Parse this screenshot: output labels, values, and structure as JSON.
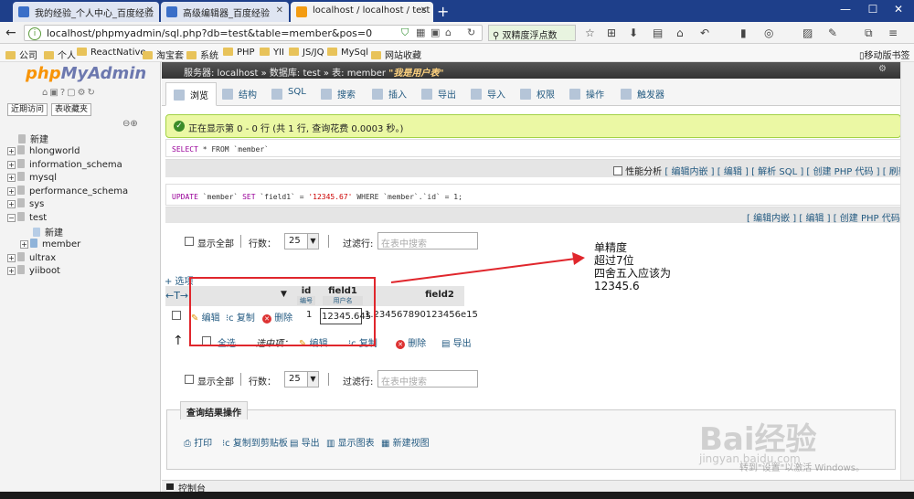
{
  "browser": {
    "tabs": [
      {
        "label": "我的经验_个人中心_百度经验"
      },
      {
        "label": "高级编辑器_百度经验"
      },
      {
        "label": "localhost / localhost / test"
      }
    ],
    "url": "localhost/phpmyadmin/sql.php?db=test&table=member&pos=0",
    "search_text": "双精度浮点数",
    "bookmarks": [
      "公司",
      "个人",
      "ReactNative",
      "淘宝套",
      "系统",
      "PHP",
      "YII",
      "JS/JQ",
      "MySql",
      "网站收藏"
    ],
    "mobile_bookmarks": "移动版书签"
  },
  "sidebar": {
    "logo_php": "php",
    "logo_myadmin": "MyAdmin",
    "recent_btn": "近期访问",
    "fav_btn": "表收藏夹",
    "tree": [
      {
        "label": "新建"
      },
      {
        "label": "hlongworld"
      },
      {
        "label": "information_schema"
      },
      {
        "label": "mysql"
      },
      {
        "label": "performance_schema"
      },
      {
        "label": "sys"
      },
      {
        "label": "test"
      },
      {
        "label": "新建"
      },
      {
        "label": "member"
      },
      {
        "label": "ultrax"
      },
      {
        "label": "yiiboot"
      }
    ]
  },
  "breadcrumb": {
    "server": "服务器: localhost »",
    "database": "数据库: test »",
    "table": "表: member",
    "comment": "\"我是用户表\""
  },
  "tabs": [
    {
      "label": "浏览"
    },
    {
      "label": "结构"
    },
    {
      "label": "SQL"
    },
    {
      "label": "搜索"
    },
    {
      "label": "插入"
    },
    {
      "label": "导出"
    },
    {
      "label": "导入"
    },
    {
      "label": "权限"
    },
    {
      "label": "操作"
    },
    {
      "label": "触发器"
    }
  ],
  "content": {
    "success_msg": "正在显示第 0 - 0 行 (共 1 行, 查询花费 0.0003 秒。)",
    "query1": {
      "kw1": "SELECT",
      "rest": " * FROM `member`"
    },
    "query1_links": {
      "profiling": "性能分析",
      "inline": "[ 编辑内嵌 ]",
      "edit": "[ 编辑 ]",
      "explain": "[ 解析 SQL ]",
      "php": "[ 创建 PHP 代码 ]",
      "refresh": "[ 刷新 ]"
    },
    "query2": {
      "kw1": "UPDATE",
      "t1": " `member` ",
      "kw2": "SET",
      "t2": " `field1` = ",
      "val": "'12345.67'",
      "t3": " WHERE `member`.`id` = 1;"
    },
    "query2_links": {
      "inline": "[ 编辑内嵌 ]",
      "edit": "[ 编辑 ]",
      "php": "[ 创建 PHP 代码 ]"
    },
    "nav": {
      "show_all": "显示全部",
      "rows_label": "行数：",
      "rows_value": "25",
      "filter_label": "过滤行:",
      "filter_placeholder": "在表中搜索"
    },
    "options_link": "+ 选项",
    "columns": {
      "id": "id",
      "id_sub": "编号",
      "field1": "field1",
      "field1_sub": "用户名",
      "field2": "field2"
    },
    "row": {
      "edit": "编辑",
      "copy": "复制",
      "delete": "删除",
      "id": "1",
      "field1": "12345.645",
      "field2": "1.234567890123456e15"
    },
    "bulk": {
      "check_all": "全选",
      "with_selected": "选中项：",
      "edit": "编辑",
      "copy": "复制",
      "delete": "删除",
      "export": "导出"
    },
    "result_ops": {
      "title": "查询结果操作",
      "print": "打印",
      "copy_clip": "复制到剪贴板",
      "export": "导出",
      "chart": "显示图表",
      "view": "新建视图"
    }
  },
  "annotation": {
    "line1": "单精度",
    "line2": "超过7位",
    "line3": "四舍五入应该为",
    "line4": "12345.6",
    "color": "#e0262c"
  },
  "console_label": "控制台",
  "watermark": {
    "main": "Bai经验",
    "sub": "jingyan.baidu.com",
    "activate": "转到\"设置\"以激活 Windows。"
  }
}
